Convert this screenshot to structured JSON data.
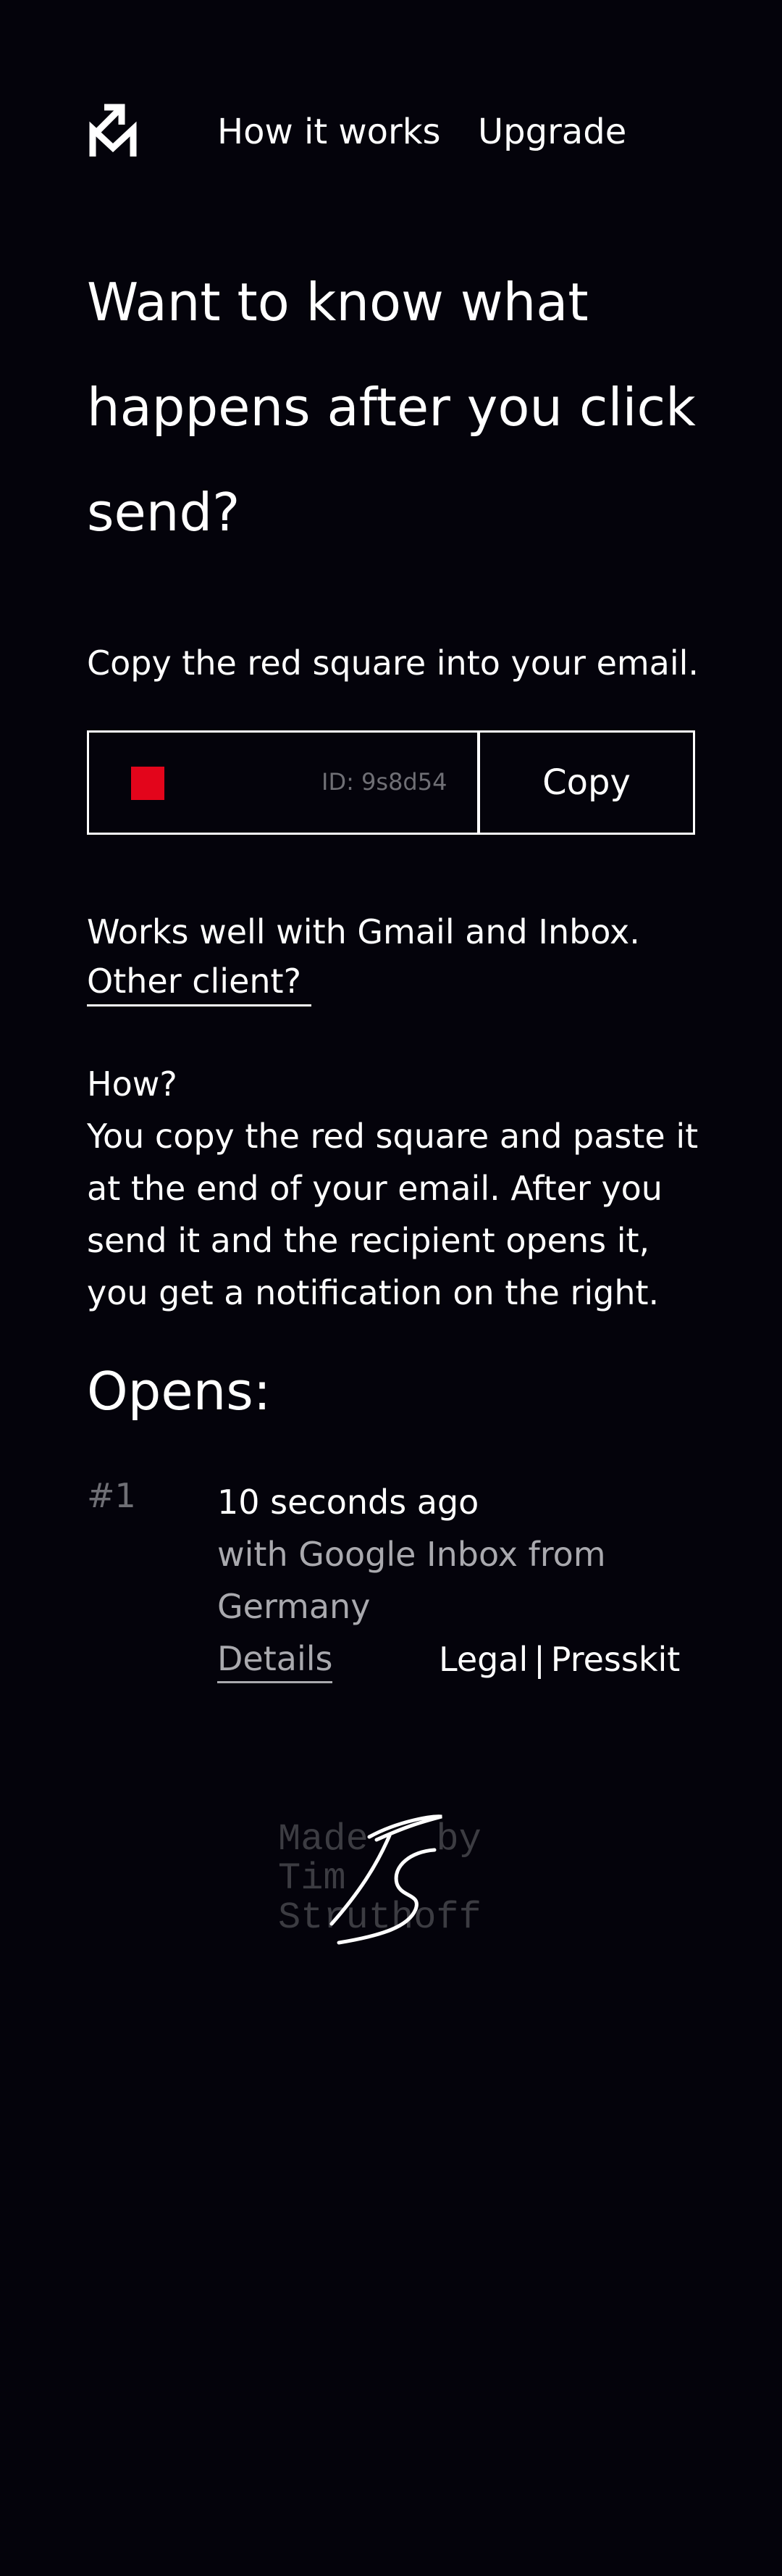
{
  "nav": {
    "logo_icon": "envelope-arrow-logo-icon",
    "links": [
      {
        "label": "How it works"
      },
      {
        "label": "Upgrade"
      }
    ]
  },
  "hero": {
    "headline": "Want to know what happens after you click send?",
    "intro": "Copy the red square into your email."
  },
  "tracker": {
    "square_color": "#e3051b",
    "id_text": "ID: 9s8d54",
    "copy_label": "Copy"
  },
  "compat": {
    "text": "Works well with Gmail and Inbox.",
    "other_link": "Other client?"
  },
  "how": {
    "heading": "How?",
    "text": "You copy the red square and paste it at the end of your email. After you send it and the recipient opens it, you get a notification on the right."
  },
  "opens": {
    "heading": "Opens:",
    "items": [
      {
        "number": "#1",
        "time": "10 seconds ago",
        "source": "with Google Inbox from Germany",
        "details_label": "Details"
      }
    ]
  },
  "footer": {
    "legal": "Legal",
    "separator": "|",
    "presskit": "Presskit",
    "made_by": [
      "Made   by",
      "Tim",
      "Struthoff"
    ],
    "signature_icon": "ts-signature-icon"
  },
  "colors": {
    "background": "#04030b",
    "text": "#ffffff",
    "muted": "#a9a9ae",
    "dim": "#6f6f75",
    "accent_red": "#e3051b"
  }
}
